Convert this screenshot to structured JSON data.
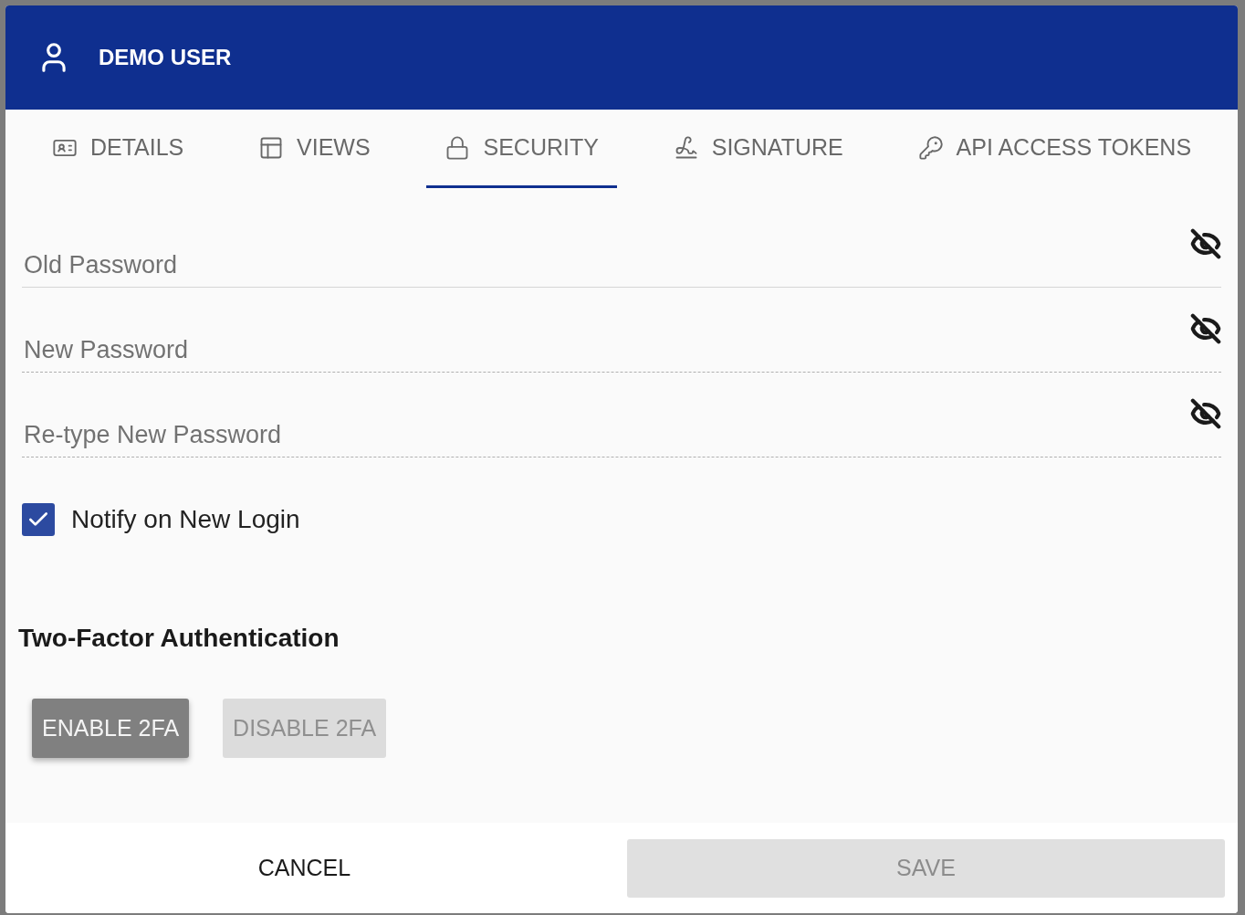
{
  "dialog": {
    "title": "DEMO USER"
  },
  "tabs": [
    {
      "label": "DETAILS",
      "kind": "details",
      "selected": false
    },
    {
      "label": "VIEWS",
      "kind": "views",
      "selected": false
    },
    {
      "label": "SECURITY",
      "kind": "security",
      "selected": true
    },
    {
      "label": "SIGNATURE",
      "kind": "signature",
      "selected": false
    },
    {
      "label": "API ACCESS TOKENS",
      "kind": "tokens",
      "selected": false
    }
  ],
  "password_fields": [
    {
      "placeholder": "Old Password",
      "disabled": false
    },
    {
      "placeholder": "New Password",
      "disabled": true
    },
    {
      "placeholder": "Re-type New Password",
      "disabled": true
    }
  ],
  "notify_checkbox": {
    "label": "Notify on New Login",
    "checked": true
  },
  "two_factor": {
    "heading": "Two-Factor Authentication",
    "buttons": [
      {
        "label": "ENABLE 2FA",
        "disabled": false
      },
      {
        "label": "DISABLE 2FA",
        "disabled": true
      }
    ]
  },
  "footer": {
    "cancel": "CANCEL",
    "save": {
      "label": "SAVE",
      "disabled": true
    }
  }
}
